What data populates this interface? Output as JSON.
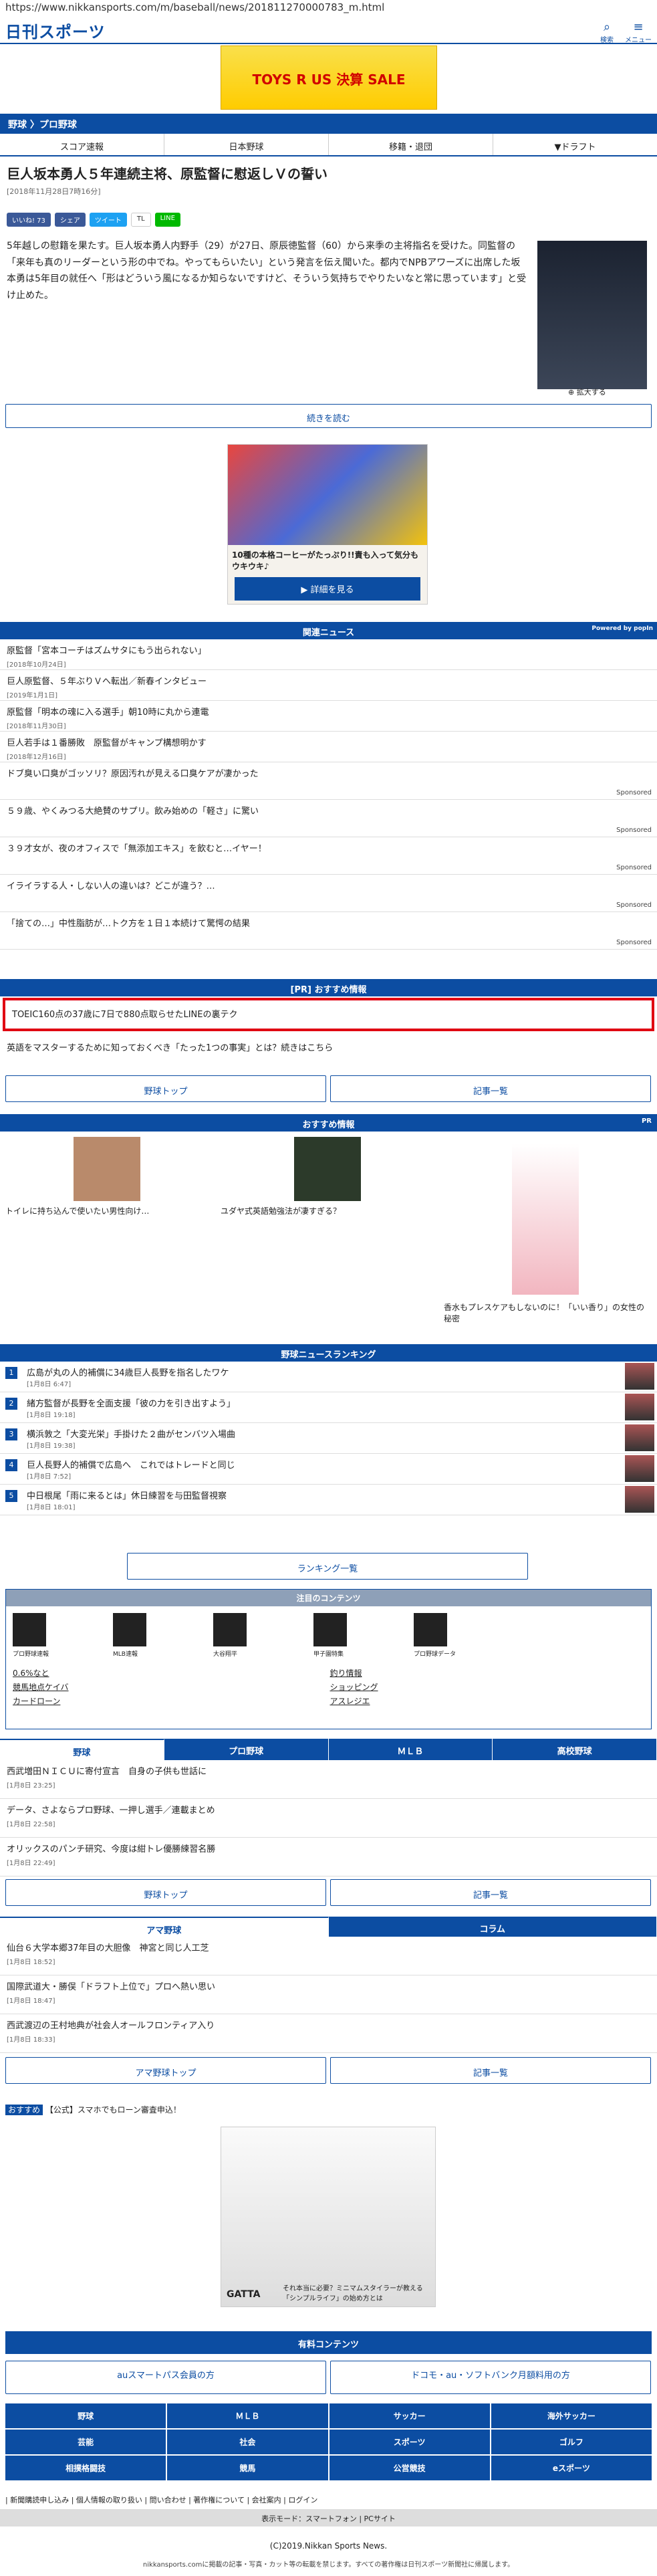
{
  "url": "https://www.nikkansports.com/m/baseball/news/201811270000783_m.html",
  "logo": "日刊スポーツ",
  "header": {
    "search": "検索",
    "menu": "メニュー"
  },
  "banner": {
    "text": "TOYS R US 決算 SALE"
  },
  "breadcrumb": "野球 〉プロ野球",
  "tabs": [
    "スコア速報",
    "日本野球",
    "移籍・退団",
    "▼ドラフト"
  ],
  "article": {
    "title": "巨人坂本勇人５年連続主将、原監督に慰返しＶの誓い",
    "date": "[2018年11月28日7時16分]",
    "body": "5年越しの慰籍を果たす。巨人坂本勇人内野手（29）が27日、原辰徳監督（60）から来季の主将指名を受けた。同監督の「来年も真のリーダーという形の中でね。やってもらいたい」という発言を伝え聞いた。都内でNPBアワーズに出席した坂本勇は5年目の就任へ「形はどういう風になるか知らないですけど、そういう気持ちでやりたいなと常に思っています」と受け止めた。",
    "enlarge": "拡大する",
    "more": "続きを読む"
  },
  "sns": [
    "いいね! 73",
    "シェア",
    "ツイート",
    "TL",
    "LINE"
  ],
  "ad1": {
    "text": "10種の本格コーヒーがたっぷり!!責も入って気分もウキウキ♪",
    "cta": "▶ 詳細を見る"
  },
  "related": {
    "title": "関連ニュース",
    "powered": "Powered by popIn",
    "items": [
      {
        "t": "原監督「宮本コーチはズムサタにもう出られない」",
        "d": "[2018年10月24日]"
      },
      {
        "t": "巨人原監督、５年ぶりＶへ転出／新春インタビュー",
        "d": "[2019年1月1日]"
      },
      {
        "t": "原監督「明本の魂に入る選手」朝10時に丸から連電",
        "d": "[2018年11月30日]"
      },
      {
        "t": "巨人若手は１番勝敗　原監督がキャンプ構想明かす",
        "d": "[2018年12月16日]"
      },
      {
        "t": "ドブ臭い口臭がゴッソリ？原因汚れが見える口臭ケアが凄かった",
        "d": "",
        "s": "Sponsored"
      },
      {
        "t": "５９歳、やくみつる大絶賛のサプリ。飲み始めの「軽さ」に驚い",
        "d": "",
        "s": "Sponsored"
      },
      {
        "t": "３９才女が、夜のオフィスで「無添加エキス」を飲むと…イヤー！",
        "d": "",
        "s": "Sponsored"
      },
      {
        "t": "イライラする人・しない人の違いは？どこが違う？…",
        "d": "",
        "s": "Sponsored"
      },
      {
        "t": "「捨ての…」中性脂肪が…トク方を１日１本続けて驚愕の結果",
        "d": "",
        "s": "Sponsored"
      }
    ]
  },
  "pr": {
    "title": "[PR] おすすめ情報",
    "highlight": "TOEIC160点の37歳に7日で880点取らせたLINEの裏テク",
    "line2": "英語をマスターするために知っておくべき「たった1つの事実」とは？続きはこちら"
  },
  "buttons": {
    "baseball_top": "野球トップ",
    "articles": "記事一覧",
    "ranking": "ランキング一覧",
    "ama_top": "アマ野球トップ"
  },
  "recommend": {
    "title": "おすすめ情報",
    "pr": "PR",
    "items": [
      "トイレに持ち込んで使いたい男性向け…",
      "ユダヤ式英語勉強法が凄すぎる？",
      "香水もプレスケアもしないのに！「いい香り」の女性の秘密"
    ]
  },
  "ranking": {
    "title": "野球ニュースランキング",
    "items": [
      {
        "n": "1",
        "t": "広島が丸の人的補償に34歳巨人長野を指名したワケ",
        "d": "[1月8日 6:47]"
      },
      {
        "n": "2",
        "t": "緒方監督が長野を全面支援「彼の力を引き出すよう」",
        "d": "[1月8日 19:18]"
      },
      {
        "n": "3",
        "t": "横浜敦之「大変光栄」手掛けた２曲がセンバツ入場曲",
        "d": "[1月8日 19:38]"
      },
      {
        "n": "4",
        "t": "巨人長野人的補償で広島へ　これではトレードと同じ",
        "d": "[1月8日 7:52]"
      },
      {
        "n": "5",
        "t": "中日根尾「雨に来るとは」休日練習を与田監督視察",
        "d": "[1月8日 18:01]"
      }
    ]
  },
  "contents": {
    "title": "注目のコンテンツ",
    "items": [
      "プロ野球速報",
      "MLB速報",
      "大谷翔平",
      "甲子園特集",
      "プロ野球データ"
    ],
    "links": [
      "0.6%なと",
      "釣り情報",
      "競馬地点ケイバ",
      "ショッピング",
      "カードローン",
      "アスレジエ"
    ]
  },
  "tabs2": [
    "野球",
    "プロ野球",
    "ＭＬＢ",
    "高校野球"
  ],
  "news2": [
    {
      "t": "西武増田ＮＩＣＵに寄付宣言　自身の子供も世話に",
      "d": "[1月8日 23:25]"
    },
    {
      "t": "データ、さよならプロ野球、一押し選手／連載まとめ",
      "d": "[1月8日 22:58]"
    },
    {
      "t": "オリックスのパンチ研究、今度は紺トレ優勝練習名勝",
      "d": "[1月8日 22:49]"
    }
  ],
  "tabs3": [
    "アマ野球",
    "コラム"
  ],
  "news3": [
    {
      "t": "仙台６大学本郷37年目の大胆像　神宮と同じ人工芝",
      "d": "[1月8日 18:52]"
    },
    {
      "t": "国際武道大・勝俣「ドラフト上位で」プロへ熱い思い",
      "d": "[1月8日 18:47]"
    },
    {
      "t": "西武渡辺の王村地典が社会人オールフロンティア入り",
      "d": "[1月8日 18:33]"
    }
  ],
  "osusume": {
    "tag": "おすすめ",
    "text": "【公式】スマホでもローン審査申込！"
  },
  "ad2": {
    "brand": "GATTA",
    "text": "それ本当に必要？ミニマムスタイラーが教える「シンプルライフ」の始め方とは"
  },
  "paid": {
    "title": "有料コンテンツ",
    "au": "auスマートパス会員の方",
    "docomo": "ドコモ・au・ソフトバンク月額料用の方"
  },
  "nav": [
    "野球",
    "ＭＬＢ",
    "サッカー",
    "海外サッカー",
    "芸能",
    "社会",
    "スポーツ",
    "ゴルフ",
    "相撲格闘技",
    "競馬",
    "公営競技",
    "eスポーツ"
  ],
  "footlinks": "| 新聞購読申し込み | 個人情報の取り扱い | 問い合わせ | 著作権について | 会社案内 | ログイン",
  "mode": "表示モード：スマートフォン | PCサイト",
  "copyright": "(C)2019.Nikkan Sports News.",
  "notice": "nikkansports.comに掲載の記事・写真・カット等の転載を禁じます。すべての著作権は日刊スポーツ新聞社に帰属します。"
}
